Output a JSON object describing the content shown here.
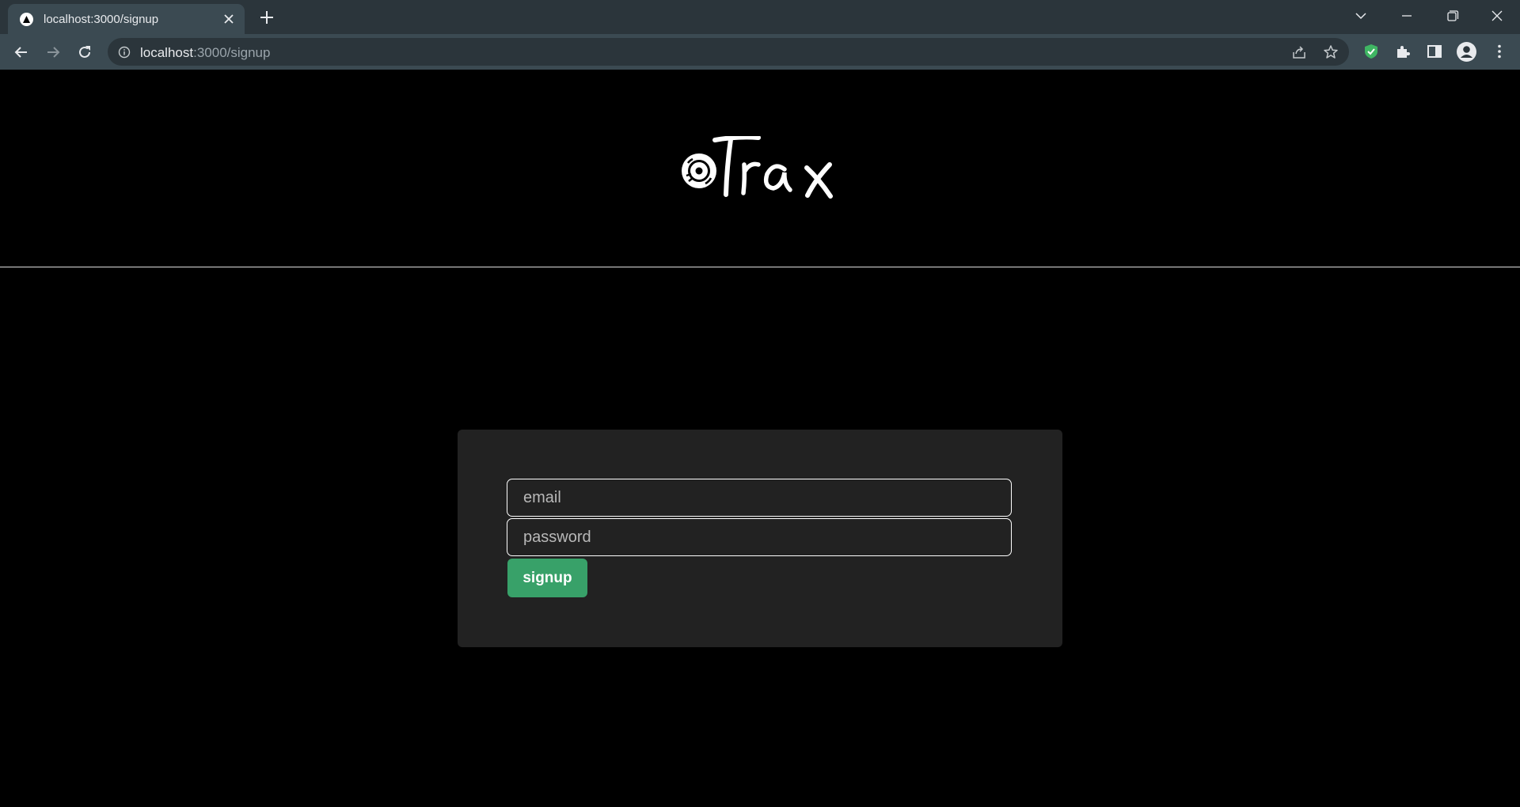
{
  "browser": {
    "tab_title": "localhost:3000/signup",
    "url_host": "localhost",
    "url_path": ":3000/signup"
  },
  "form": {
    "email_placeholder": "email",
    "password_placeholder": "password",
    "submit_label": "signup"
  },
  "colors": {
    "page_background": "#000000",
    "card_background": "#222222",
    "button": "#38a169"
  }
}
